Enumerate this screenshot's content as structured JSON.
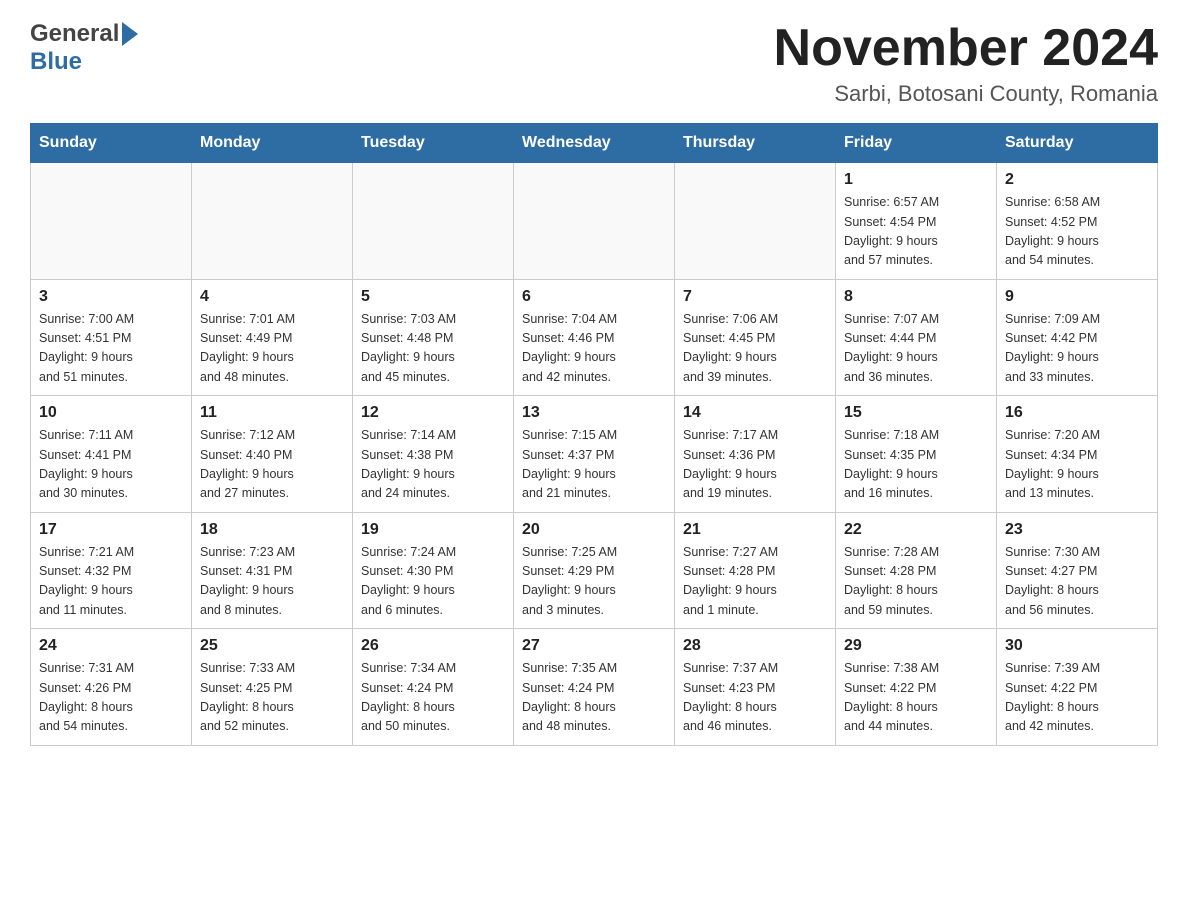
{
  "header": {
    "month_title": "November 2024",
    "location": "Sarbi, Botosani County, Romania",
    "logo_general": "General",
    "logo_blue": "Blue"
  },
  "days_of_week": [
    "Sunday",
    "Monday",
    "Tuesday",
    "Wednesday",
    "Thursday",
    "Friday",
    "Saturday"
  ],
  "weeks": [
    [
      {
        "day": "",
        "info": ""
      },
      {
        "day": "",
        "info": ""
      },
      {
        "day": "",
        "info": ""
      },
      {
        "day": "",
        "info": ""
      },
      {
        "day": "",
        "info": ""
      },
      {
        "day": "1",
        "info": "Sunrise: 6:57 AM\nSunset: 4:54 PM\nDaylight: 9 hours\nand 57 minutes."
      },
      {
        "day": "2",
        "info": "Sunrise: 6:58 AM\nSunset: 4:52 PM\nDaylight: 9 hours\nand 54 minutes."
      }
    ],
    [
      {
        "day": "3",
        "info": "Sunrise: 7:00 AM\nSunset: 4:51 PM\nDaylight: 9 hours\nand 51 minutes."
      },
      {
        "day": "4",
        "info": "Sunrise: 7:01 AM\nSunset: 4:49 PM\nDaylight: 9 hours\nand 48 minutes."
      },
      {
        "day": "5",
        "info": "Sunrise: 7:03 AM\nSunset: 4:48 PM\nDaylight: 9 hours\nand 45 minutes."
      },
      {
        "day": "6",
        "info": "Sunrise: 7:04 AM\nSunset: 4:46 PM\nDaylight: 9 hours\nand 42 minutes."
      },
      {
        "day": "7",
        "info": "Sunrise: 7:06 AM\nSunset: 4:45 PM\nDaylight: 9 hours\nand 39 minutes."
      },
      {
        "day": "8",
        "info": "Sunrise: 7:07 AM\nSunset: 4:44 PM\nDaylight: 9 hours\nand 36 minutes."
      },
      {
        "day": "9",
        "info": "Sunrise: 7:09 AM\nSunset: 4:42 PM\nDaylight: 9 hours\nand 33 minutes."
      }
    ],
    [
      {
        "day": "10",
        "info": "Sunrise: 7:11 AM\nSunset: 4:41 PM\nDaylight: 9 hours\nand 30 minutes."
      },
      {
        "day": "11",
        "info": "Sunrise: 7:12 AM\nSunset: 4:40 PM\nDaylight: 9 hours\nand 27 minutes."
      },
      {
        "day": "12",
        "info": "Sunrise: 7:14 AM\nSunset: 4:38 PM\nDaylight: 9 hours\nand 24 minutes."
      },
      {
        "day": "13",
        "info": "Sunrise: 7:15 AM\nSunset: 4:37 PM\nDaylight: 9 hours\nand 21 minutes."
      },
      {
        "day": "14",
        "info": "Sunrise: 7:17 AM\nSunset: 4:36 PM\nDaylight: 9 hours\nand 19 minutes."
      },
      {
        "day": "15",
        "info": "Sunrise: 7:18 AM\nSunset: 4:35 PM\nDaylight: 9 hours\nand 16 minutes."
      },
      {
        "day": "16",
        "info": "Sunrise: 7:20 AM\nSunset: 4:34 PM\nDaylight: 9 hours\nand 13 minutes."
      }
    ],
    [
      {
        "day": "17",
        "info": "Sunrise: 7:21 AM\nSunset: 4:32 PM\nDaylight: 9 hours\nand 11 minutes."
      },
      {
        "day": "18",
        "info": "Sunrise: 7:23 AM\nSunset: 4:31 PM\nDaylight: 9 hours\nand 8 minutes."
      },
      {
        "day": "19",
        "info": "Sunrise: 7:24 AM\nSunset: 4:30 PM\nDaylight: 9 hours\nand 6 minutes."
      },
      {
        "day": "20",
        "info": "Sunrise: 7:25 AM\nSunset: 4:29 PM\nDaylight: 9 hours\nand 3 minutes."
      },
      {
        "day": "21",
        "info": "Sunrise: 7:27 AM\nSunset: 4:28 PM\nDaylight: 9 hours\nand 1 minute."
      },
      {
        "day": "22",
        "info": "Sunrise: 7:28 AM\nSunset: 4:28 PM\nDaylight: 8 hours\nand 59 minutes."
      },
      {
        "day": "23",
        "info": "Sunrise: 7:30 AM\nSunset: 4:27 PM\nDaylight: 8 hours\nand 56 minutes."
      }
    ],
    [
      {
        "day": "24",
        "info": "Sunrise: 7:31 AM\nSunset: 4:26 PM\nDaylight: 8 hours\nand 54 minutes."
      },
      {
        "day": "25",
        "info": "Sunrise: 7:33 AM\nSunset: 4:25 PM\nDaylight: 8 hours\nand 52 minutes."
      },
      {
        "day": "26",
        "info": "Sunrise: 7:34 AM\nSunset: 4:24 PM\nDaylight: 8 hours\nand 50 minutes."
      },
      {
        "day": "27",
        "info": "Sunrise: 7:35 AM\nSunset: 4:24 PM\nDaylight: 8 hours\nand 48 minutes."
      },
      {
        "day": "28",
        "info": "Sunrise: 7:37 AM\nSunset: 4:23 PM\nDaylight: 8 hours\nand 46 minutes."
      },
      {
        "day": "29",
        "info": "Sunrise: 7:38 AM\nSunset: 4:22 PM\nDaylight: 8 hours\nand 44 minutes."
      },
      {
        "day": "30",
        "info": "Sunrise: 7:39 AM\nSunset: 4:22 PM\nDaylight: 8 hours\nand 42 minutes."
      }
    ]
  ],
  "colors": {
    "header_bg": "#2e6da4",
    "header_text": "#ffffff",
    "border": "#cccccc",
    "accent_blue": "#2e6da4"
  }
}
